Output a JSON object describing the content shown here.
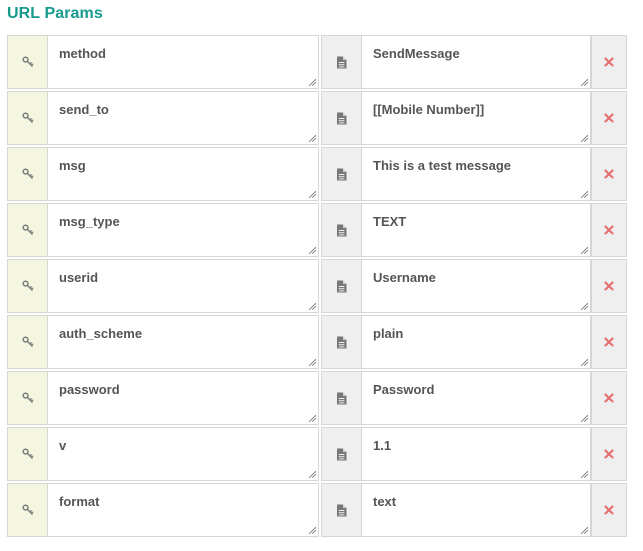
{
  "section_title": "URL Params",
  "icons": {
    "key": "key-icon",
    "value": "document-icon",
    "delete": "close-icon"
  },
  "colors": {
    "title": "#159a8c",
    "key_addon_bg": "#f4f6e0",
    "value_addon_bg": "#efefef",
    "delete": "#e57373"
  },
  "params": [
    {
      "key": "method",
      "value": "SendMessage"
    },
    {
      "key": "send_to",
      "value": "[[Mobile Number]]"
    },
    {
      "key": "msg",
      "value": "This is a test message"
    },
    {
      "key": "msg_type",
      "value": "TEXT"
    },
    {
      "key": "userid",
      "value": "Username"
    },
    {
      "key": "auth_scheme",
      "value": "plain"
    },
    {
      "key": "password",
      "value": "Password"
    },
    {
      "key": "v",
      "value": "1.1"
    },
    {
      "key": "format",
      "value": "text"
    }
  ]
}
